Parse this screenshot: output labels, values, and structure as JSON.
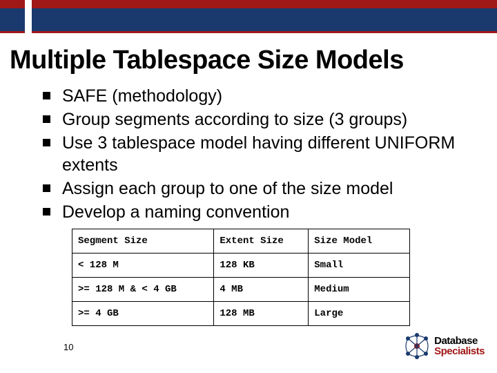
{
  "title": "Multiple Tablespace Size Models",
  "bullets": [
    "SAFE (methodology)",
    "Group segments according to size (3 groups)",
    "Use 3 tablespace model having different UNIFORM extents",
    "Assign each group to one of the size model",
    "Develop a naming convention"
  ],
  "table": {
    "headers": [
      "Segment Size",
      "Extent Size",
      "Size Model"
    ],
    "rows": [
      [
        "< 128 M",
        "128 KB",
        "Small"
      ],
      [
        ">= 128 M & < 4 GB",
        "4 MB",
        "Medium"
      ],
      [
        ">= 4 GB",
        "128 MB",
        "Large"
      ]
    ]
  },
  "page_number": "10",
  "logo": {
    "word1": "Database",
    "word2": "Specialists"
  }
}
